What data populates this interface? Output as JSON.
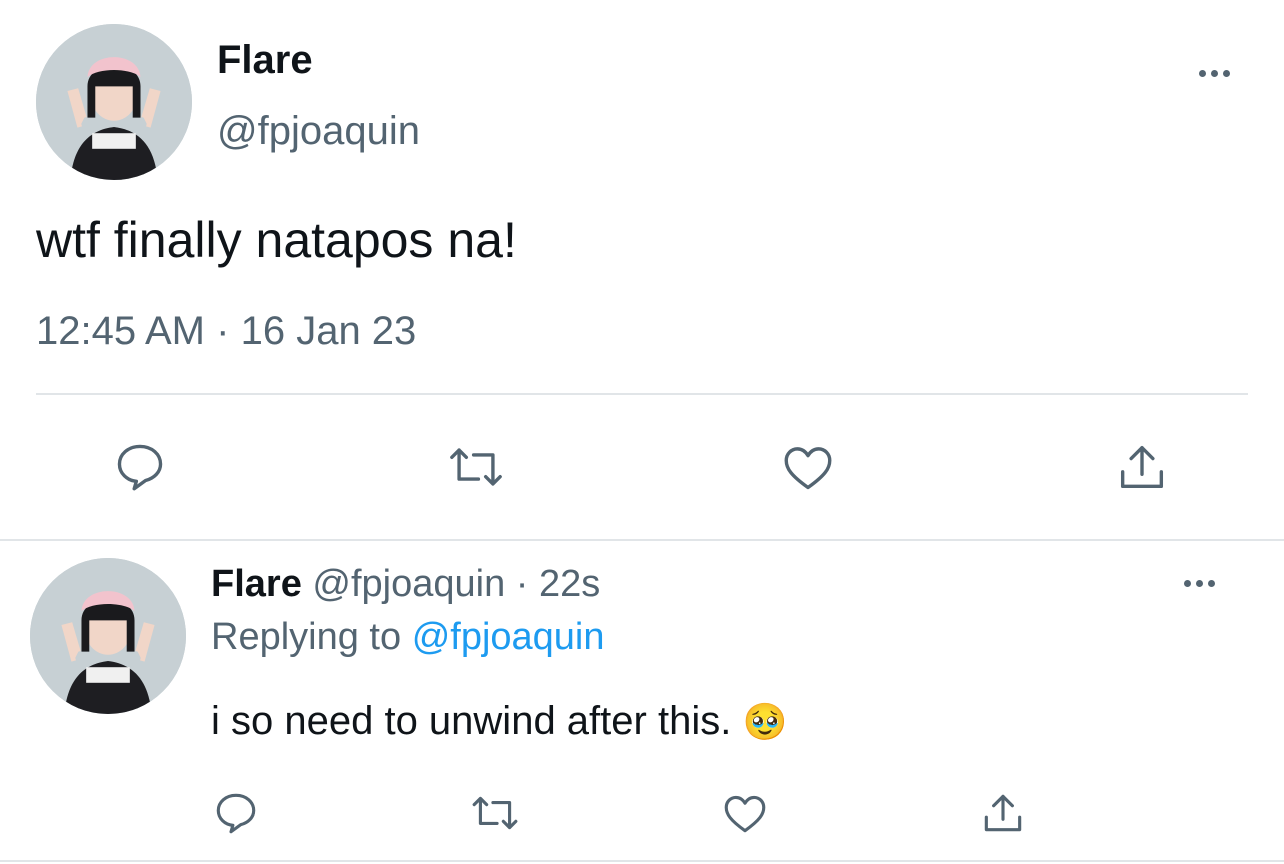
{
  "main_tweet": {
    "display_name": "Flare",
    "handle": "@fpjoaquin",
    "text": "wtf finally natapos na!",
    "time": "12:45 AM",
    "separator": "·",
    "date": "16 Jan 23",
    "avatar_icon": "avatar-photo"
  },
  "reply_tweet": {
    "display_name": "Flare",
    "handle": "@fpjoaquin",
    "separator": "·",
    "age": "22s",
    "replying_prefix": "Replying to",
    "replying_handle": "@fpjoaquin",
    "text": "i so need to unwind after this.",
    "emoji": "🥹",
    "avatar_icon": "avatar-photo"
  },
  "actions": [
    "reply-icon",
    "retweet-icon",
    "like-icon",
    "share-icon"
  ],
  "colors": {
    "text": "#0f1419",
    "muted": "#536471",
    "link": "#1d9bf0",
    "divider": "#e1e5e8"
  }
}
